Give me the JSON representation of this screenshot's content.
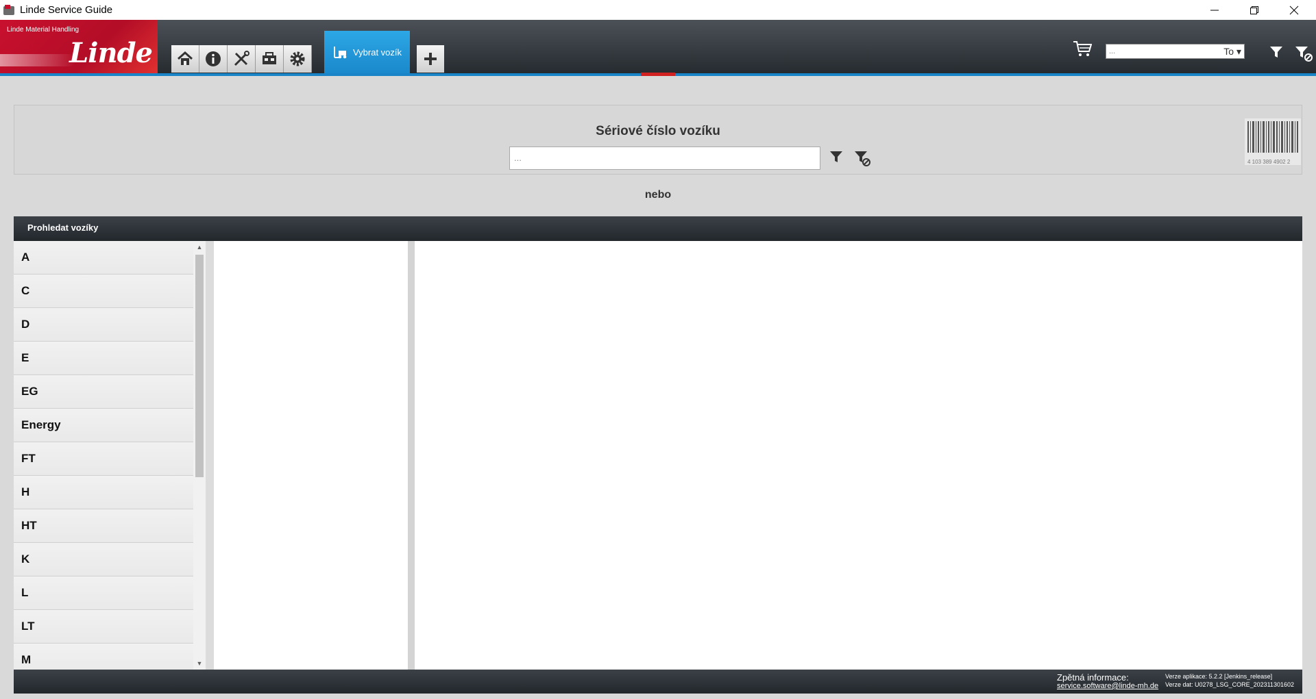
{
  "window": {
    "title": "Linde Service Guide"
  },
  "logo": {
    "subtitle": "Linde Material Handling",
    "brand": "Linde"
  },
  "toolbar": {
    "buttons": [
      "home-icon",
      "info-icon",
      "tools-icon",
      "truck-toolbox-icon",
      "gear-icon"
    ],
    "active_tab_label": "Vybrat vozík",
    "add_tab": "plus-icon"
  },
  "top_search": {
    "placeholder": "...",
    "dropdown_value": "To"
  },
  "serial": {
    "title": "Sériové číslo vozíku",
    "input_placeholder": "...",
    "barcode_digits": "4 103 389 4902 2"
  },
  "or_label": "nebo",
  "browse": {
    "header": "Prohledat vozíky",
    "series": [
      "A",
      "C",
      "D",
      "E",
      "EG",
      "Energy",
      "FT",
      "H",
      "HT",
      "K",
      "L",
      "LT",
      "M"
    ]
  },
  "footer": {
    "feedback_label": "Zpětná informace:",
    "feedback_email": "service.software@linde-mh.de",
    "app_version": "Verze aplikace: 5.2.2 [Jenkins_release]",
    "data_version": "Verze dat: U0278_LSG_CORE_202311301602"
  },
  "colors": {
    "accent_blue": "#1a84c8",
    "brand_red": "#c8102e",
    "header_dark": "#262b30"
  }
}
